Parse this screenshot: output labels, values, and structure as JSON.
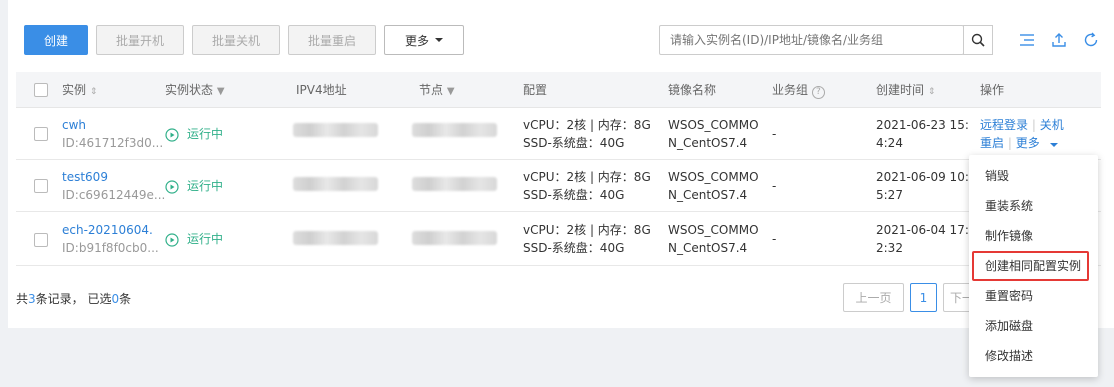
{
  "toolbar": {
    "create": "创建",
    "batch_start": "批量开机",
    "batch_stop": "批量关机",
    "batch_restart": "批量重启",
    "more": "更多",
    "search_placeholder": "请输入实例名(ID)/IP地址/镜像名/业务组"
  },
  "icons": {
    "search": "search-icon",
    "columns": "list-settings-icon",
    "export": "upload-icon",
    "refresh": "refresh-icon"
  },
  "table": {
    "headers": [
      "实例",
      "实例状态",
      "IPV4地址",
      "节点",
      "配置",
      "镜像名称",
      "业务组",
      "创建时间",
      "操作"
    ],
    "rows": [
      {
        "name": "cwh",
        "id": "ID:461712f3d0...",
        "status": "运行中",
        "config_line1": "vCPU：2核 | 内存：8G",
        "config_line2": "SSD-系统盘：40G",
        "image_line1": "WSOS_COMMO",
        "image_line2": "N_CentOS7.4",
        "group": "-",
        "time_line1": "2021-06-23 15:0",
        "time_line2": "4:24"
      },
      {
        "name": "test609",
        "id": "ID:c69612449e...",
        "status": "运行中",
        "config_line1": "vCPU：2核 | 内存：8G",
        "config_line2": "SSD-系统盘：40G",
        "image_line1": "WSOS_COMMO",
        "image_line2": "N_CentOS7.4",
        "group": "-",
        "time_line1": "2021-06-09 10:2",
        "time_line2": "5:27"
      },
      {
        "name": "ech-20210604...",
        "id": "ID:b91f8f0cb0...",
        "status": "运行中",
        "config_line1": "vCPU：2核 | 内存：8G",
        "config_line2": "SSD-系统盘：40G",
        "image_line1": "WSOS_COMMO",
        "image_line2": "N_CentOS7.4",
        "group": "-",
        "time_line1": "2021-06-04 17:2",
        "time_line2": "2:32"
      }
    ],
    "actions": {
      "remote_login": "远程登录",
      "shutdown": "关机",
      "restart": "重启",
      "more": "更多"
    }
  },
  "footer": {
    "summary_prefix": "共",
    "total": "3",
    "summary_mid": "条记录， 已选",
    "selected": "0",
    "summary_suffix": "条",
    "prev": "上一页",
    "page": "1",
    "next": "下一"
  },
  "dropdown": {
    "items": [
      "销毁",
      "重装系统",
      "制作镜像",
      "创建相同配置实例",
      "重置密码",
      "添加磁盘",
      "修改描述"
    ]
  },
  "colors": {
    "primary": "#3a8ee6",
    "link": "#2c7fd6",
    "running": "#31b08a",
    "highlight": "#e53935"
  }
}
